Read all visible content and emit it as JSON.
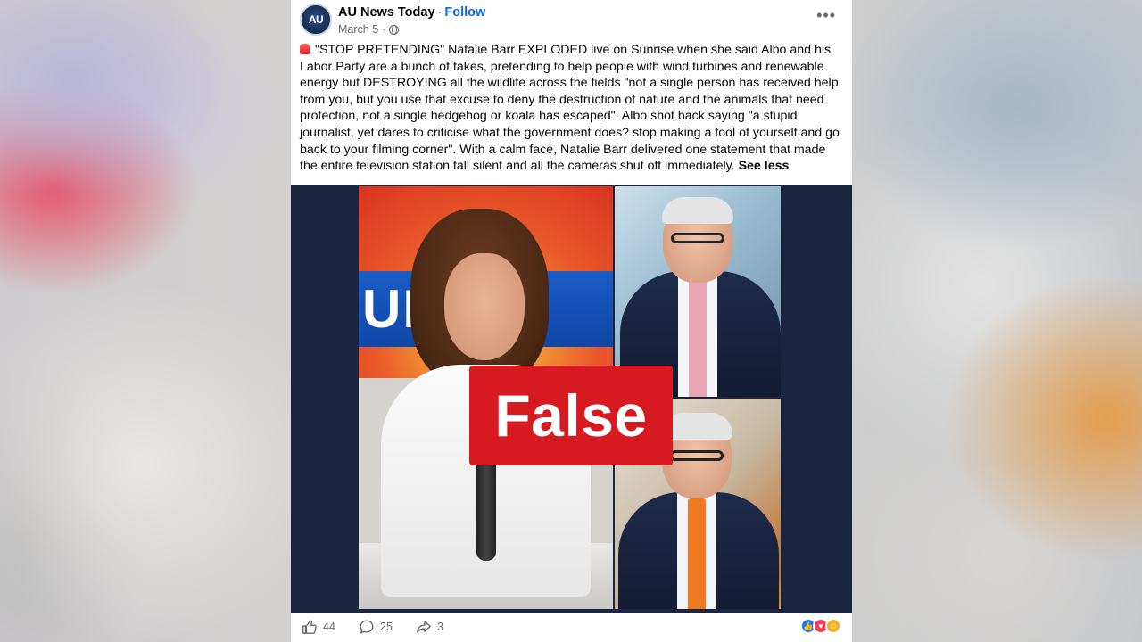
{
  "post": {
    "page_name": "AU News Today",
    "follow_label": "Follow",
    "date": "March 5",
    "avatar_text": "AU",
    "caption": "\"STOP PRETENDING\" Natalie Barr EXPLODED live on Sunrise when she said Albo and his Labor Party are a bunch of fakes, pretending to help people with wind turbines and renewable energy but DESTROYING all the wildlife across the fields \"not a single person has received help from you, but you use that excuse to deny the destruction of nature and the animals that need protection, not a single hedgehog or koala has escaped\". Albo shot back saying \"a stupid journalist, yet dares to criticise what the government does? stop making a fool of yourself and go back to your filming corner\". With a calm face, Natalie Barr delivered one statement that made the entire television station fall silent and all the cameras shut off immediately.",
    "see_less": "See less",
    "studio_text": "UNS",
    "fact_check_label": "False",
    "likes": "44",
    "comments": "25",
    "shares": "3"
  },
  "icons": {
    "caption_prefix": "fire-icon",
    "privacy": "globe-icon",
    "menu": "more-icon"
  },
  "colors": {
    "follow": "#0866ff",
    "false_badge": "#d71920",
    "media_bg": "#1b2540"
  }
}
